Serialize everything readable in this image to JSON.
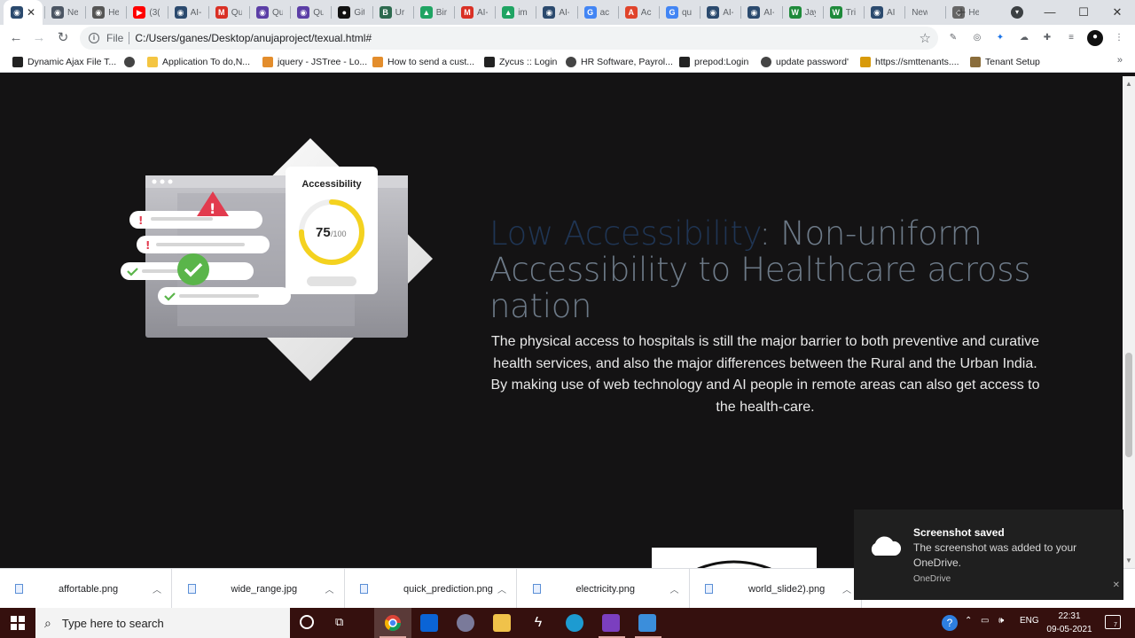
{
  "browser": {
    "active_tab_title": "",
    "tabs": [
      {
        "title": "New Ta",
        "icon": "globe",
        "color": "#4b5563"
      },
      {
        "title": "He",
        "icon": "globe-dark",
        "color": "#555555"
      },
      {
        "title": "(3(",
        "icon": "youtube",
        "color": "#ff0000"
      },
      {
        "title": "AI-",
        "icon": "site-icon",
        "color": "#2b4a6e"
      },
      {
        "title": "Qu",
        "icon": "gmail",
        "color": "#d93025"
      },
      {
        "title": "Qu",
        "icon": "site-purple",
        "color": "#5b3ea6"
      },
      {
        "title": "Qu",
        "icon": "site-purple",
        "color": "#5b3ea6"
      },
      {
        "title": "Git",
        "icon": "github",
        "color": "#111111"
      },
      {
        "title": "Ur",
        "icon": "b-icon",
        "color": "#2d6a4f"
      },
      {
        "title": "Bir",
        "icon": "drive",
        "color": "#1fa463"
      },
      {
        "title": "AI-",
        "icon": "gmail",
        "color": "#d93025"
      },
      {
        "title": "im",
        "icon": "drive",
        "color": "#1fa463"
      },
      {
        "title": "AI-",
        "icon": "site-icon",
        "color": "#2b4a6e"
      },
      {
        "title": "ac",
        "icon": "google",
        "color": "#4285f4"
      },
      {
        "title": "Ac",
        "icon": "pdf",
        "color": "#e0442b"
      },
      {
        "title": "qu",
        "icon": "google",
        "color": "#4285f4"
      },
      {
        "title": "AI-",
        "icon": "site-icon",
        "color": "#2b4a6e"
      },
      {
        "title": "AI-",
        "icon": "site-icon",
        "color": "#2b4a6e"
      },
      {
        "title": "Jay",
        "icon": "w-icon",
        "color": "#1e8a3a"
      },
      {
        "title": "Tri",
        "icon": "w-icon",
        "color": "#1e8a3a"
      },
      {
        "title": "AI",
        "icon": "site-icon",
        "color": "#2b4a6e"
      },
      {
        "title": "New Ta",
        "icon": "none",
        "color": "#dee1e6"
      },
      {
        "title": "He",
        "icon": "diamond",
        "color": "#666666"
      }
    ],
    "address": {
      "scheme": "File",
      "url": "C:/Users/ganes/Desktop/anujaproject/texual.html#"
    },
    "bookmarks": [
      {
        "label": "Dynamic Ajax File T...",
        "color": "#222222"
      },
      {
        "label": "",
        "color": "#444444"
      },
      {
        "label": "Application To do,N...",
        "color": "#f4c542"
      },
      {
        "label": "jquery - JSTree - Lo...",
        "color": "#e38d2c"
      },
      {
        "label": "How to send a cust...",
        "color": "#e38d2c"
      },
      {
        "label": "Zycus :: Login",
        "color": "#222222"
      },
      {
        "label": "HR Software, Payrol...",
        "color": "#444444"
      },
      {
        "label": "prepod:Login",
        "color": "#222222"
      },
      {
        "label": "update password'",
        "color": "#444444"
      },
      {
        "label": "https://smttenants....",
        "color": "#d89a0a"
      },
      {
        "label": "Tenant Setup",
        "color": "#8a6d3b"
      }
    ],
    "bookmarks_more": "»"
  },
  "page": {
    "illustration": {
      "card_title": "Accessibility",
      "score": "75",
      "score_max": "/100",
      "score_fraction": 0.75
    },
    "headline_accent": "Low Accessibility",
    "headline_rest": ": Non-uniform Accessibility to Healthcare across nation",
    "paragraph": "The physical access to hospitals is still the major barrier to both preventive and curative health services, and also the major differences between the Rural and the Urban India. By making use of web technology and AI people in remote areas can also get access to the health-care."
  },
  "downloads": [
    {
      "name": "affortable.png"
    },
    {
      "name": "wide_range.jpg"
    },
    {
      "name": "quick_prediction.png"
    },
    {
      "name": "electricity.png"
    },
    {
      "name": "world_slide2).png"
    }
  ],
  "toast": {
    "title": "Screenshot saved",
    "body": "The screenshot was added to your OneDrive.",
    "source": "OneDrive"
  },
  "taskbar": {
    "search_placeholder": "Type here to search",
    "language": "ENG",
    "time": "22:31",
    "date": "09-05-2021",
    "notification_count": "7"
  }
}
